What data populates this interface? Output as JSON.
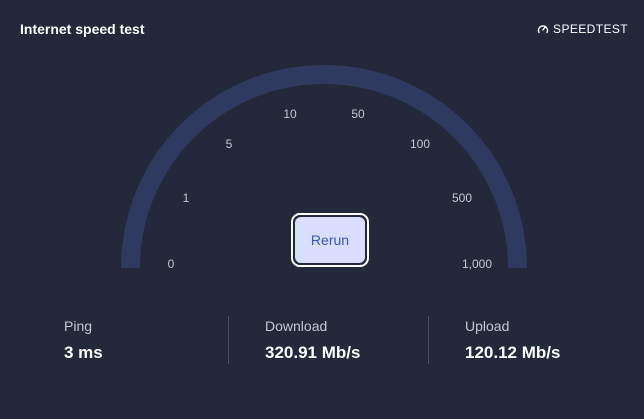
{
  "header": {
    "title": "Internet speed test",
    "brand_label": "SPEEDTEST",
    "brand_icon": "speedometer-icon"
  },
  "gauge": {
    "track_color": "#2f3a60",
    "ticks": [
      "0",
      "1",
      "5",
      "10",
      "50",
      "100",
      "500",
      "1,000"
    ]
  },
  "rerun_button": {
    "label": "Rerun",
    "background": "#dadefd",
    "text_color": "#3b54b9"
  },
  "stats": {
    "ping": {
      "label": "Ping",
      "value": "3 ms"
    },
    "download": {
      "label": "Download",
      "value": "320.91 Mb/s"
    },
    "upload": {
      "label": "Upload",
      "value": "120.12 Mb/s"
    }
  },
  "colors": {
    "background": "#23283a",
    "text_primary": "#ffffff",
    "text_secondary": "#c5c8d2",
    "divider": "#4a5063"
  }
}
